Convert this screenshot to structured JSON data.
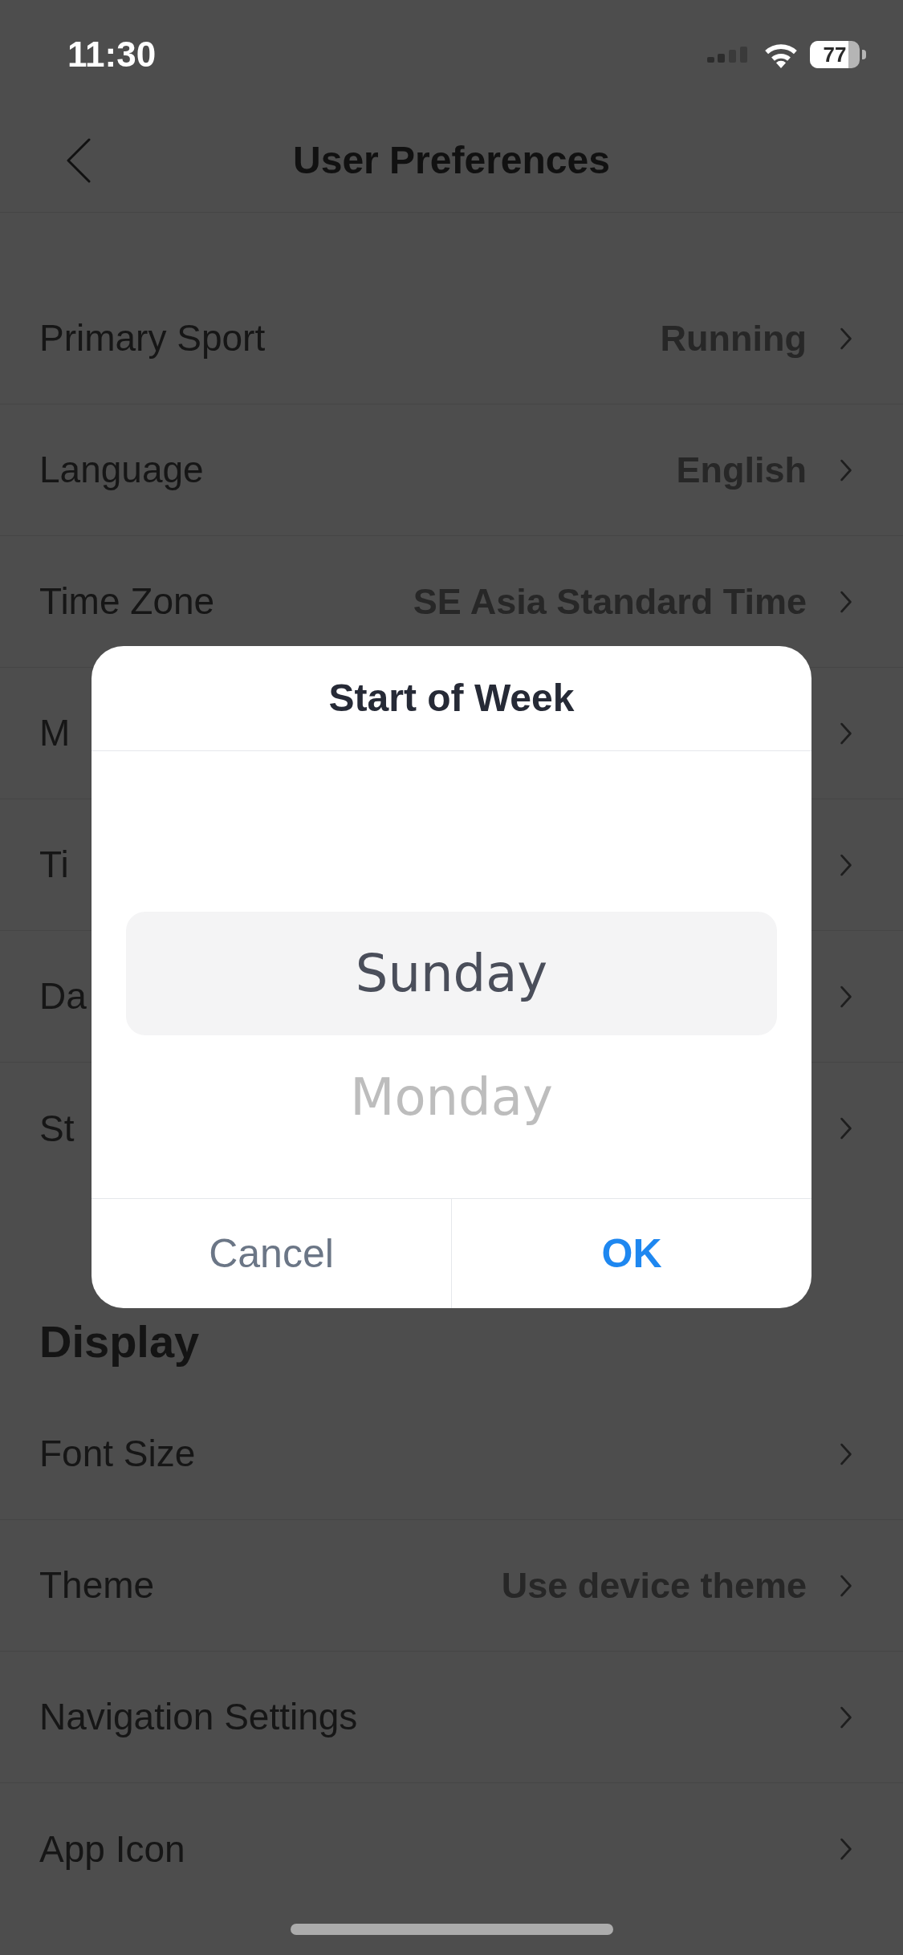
{
  "status_bar": {
    "time": "11:30",
    "battery": "77"
  },
  "nav": {
    "title": "User Preferences"
  },
  "sections": [
    {
      "rows": [
        {
          "label": "Primary Sport",
          "value": "Running"
        },
        {
          "label": "Language",
          "value": "English"
        },
        {
          "label": "Time Zone",
          "value": "SE Asia Standard Time"
        },
        {
          "label": "M"
        },
        {
          "label": "Ti"
        },
        {
          "label": "Da"
        },
        {
          "label": "St"
        }
      ]
    },
    {
      "title": "Display",
      "rows": [
        {
          "label": "Font Size"
        },
        {
          "label": "Theme",
          "value": "Use device theme"
        },
        {
          "label": "Navigation Settings"
        },
        {
          "label": "App Icon"
        }
      ]
    }
  ],
  "dialog": {
    "title": "Start of Week",
    "options": [
      {
        "label": "Sunday",
        "selected": true
      },
      {
        "label": "Monday",
        "selected": false
      }
    ],
    "buttons": [
      {
        "label": "Cancel",
        "kind": "cancel"
      },
      {
        "label": "OK",
        "kind": "confirm"
      }
    ]
  }
}
